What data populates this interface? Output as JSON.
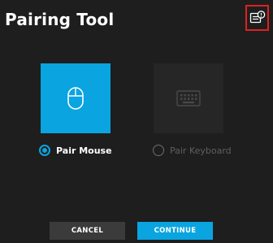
{
  "header": {
    "title": "Pairing Tool"
  },
  "devices": {
    "mouse": {
      "label": "Pair Mouse",
      "selected": true
    },
    "keyboard": {
      "label": "Pair Keyboard",
      "selected": false
    }
  },
  "actions": {
    "cancel_label": "CANCEL",
    "continue_label": "CONTINUE"
  },
  "colors": {
    "accent": "#0aa4e0",
    "background": "#1e1e1e",
    "highlight_border": "#e02020"
  },
  "icons": {
    "header_button": "device-info-icon",
    "mouse_tile": "mouse-icon",
    "keyboard_tile": "keyboard-icon"
  }
}
